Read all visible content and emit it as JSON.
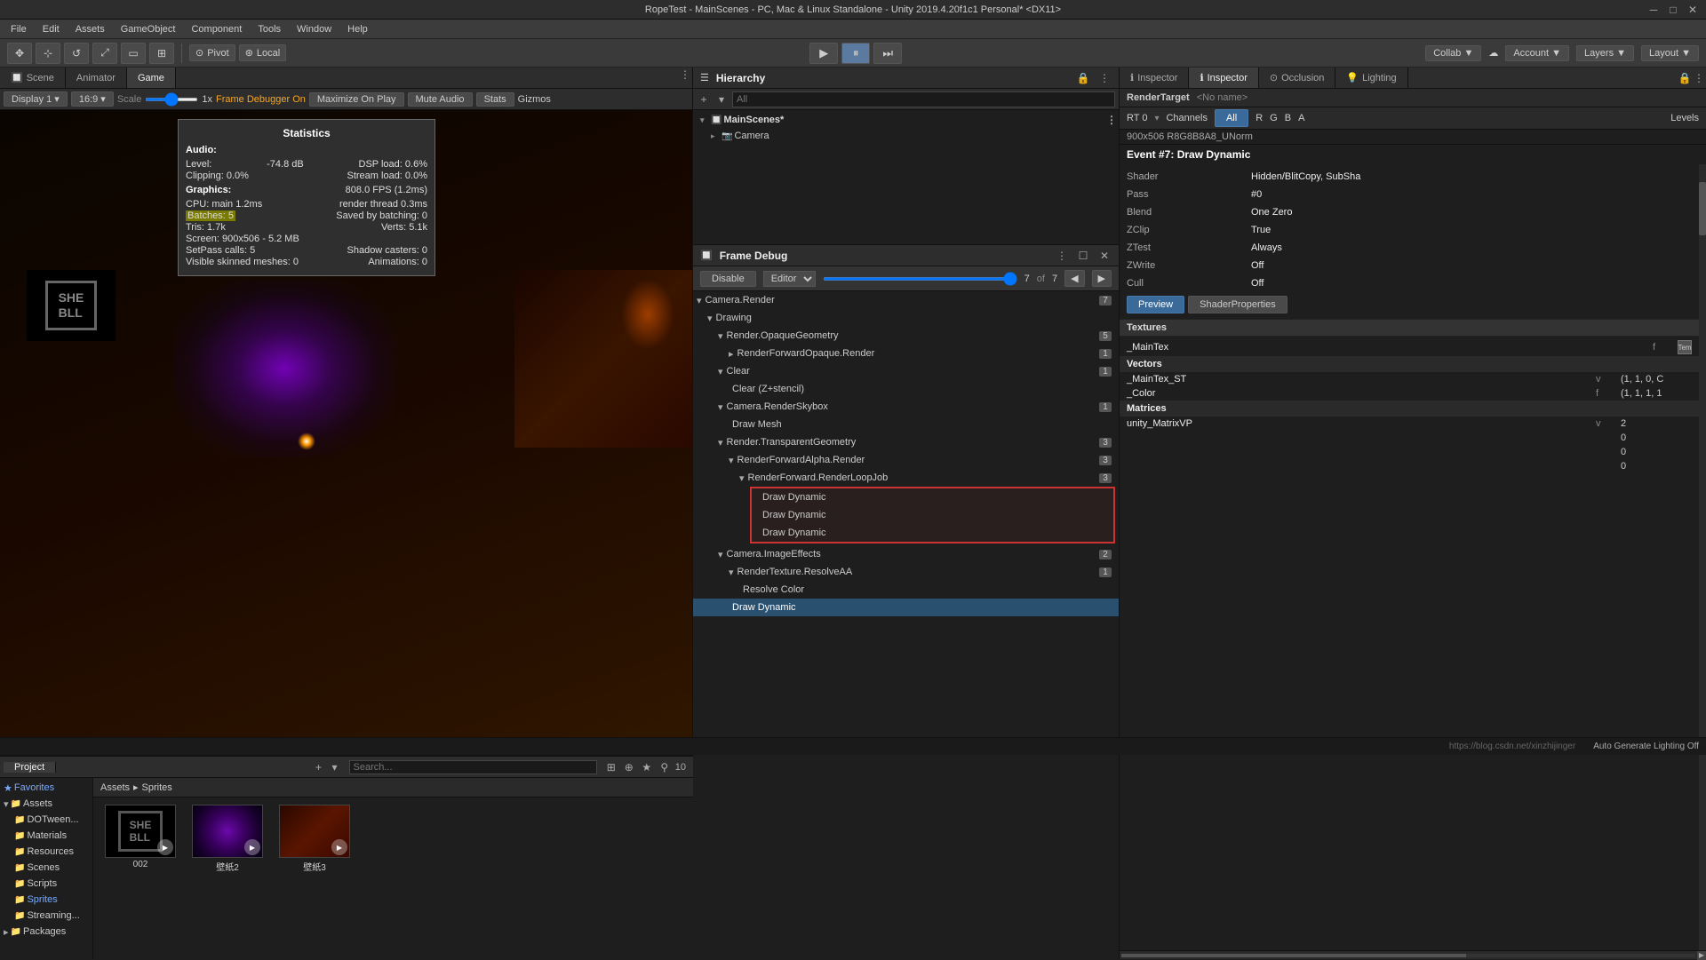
{
  "window": {
    "title": "RopeTest - MainScenes - PC, Mac & Linux Standalone - Unity 2019.4.20f1c1 Personal* <DX11>"
  },
  "menu": {
    "items": [
      "File",
      "Edit",
      "Assets",
      "GameObject",
      "Component",
      "Tools",
      "Window",
      "Help"
    ]
  },
  "toolbar": {
    "pivot_label": "Pivot",
    "local_label": "Local",
    "play_icon": "▶",
    "pause_icon": "⏸",
    "step_icon": "⏭",
    "collab_label": "Collab ▼",
    "account_label": "Account ▼",
    "layers_label": "Layers ▼",
    "layout_label": "Layout ▼"
  },
  "scene_tab": {
    "label": "Scene",
    "animator_label": "Animator",
    "game_label": "Game",
    "display_label": "Display 1",
    "aspect_label": "16:9",
    "scale_label": "Scale",
    "scale_value": "1x",
    "frame_debugger_label": "Frame Debugger On",
    "maximize_on_play": "Maximize On Play",
    "mute_audio": "Mute Audio",
    "stats_label": "Stats",
    "gizmos_label": "Gizmos"
  },
  "statistics": {
    "title": "Statistics",
    "audio": {
      "label": "Audio:",
      "level_label": "Level:",
      "level_value": "-74.8 dB",
      "dsp_label": "DSP load: 0.6%",
      "clipping_label": "Clipping: 0.0%",
      "stream_label": "Stream load: 0.0%"
    },
    "graphics": {
      "label": "Graphics:",
      "fps_label": "808.0 FPS (1.2ms)",
      "cpu_label": "CPU: main 1.2ms",
      "cpu_value": "render thread 0.3ms",
      "batches_label": "Batches: 5",
      "saved_label": "Saved by batching: 0",
      "tris_label": "Tris: 1.7k",
      "verts_label": "Verts: 5.1k",
      "screen_label": "Screen: 900x506 - 5.2 MB",
      "setpass_label": "SetPass calls: 5",
      "shadow_label": "Shadow casters: 0",
      "skinned_label": "Visible skinned meshes: 0",
      "animations_label": "Animations: 0"
    }
  },
  "hierarchy": {
    "title": "Hierarchy",
    "search_placeholder": "All",
    "items": [
      {
        "label": "MainScenes*",
        "indent": 0,
        "expanded": true,
        "is_scene": true
      },
      {
        "label": "Camera",
        "indent": 1,
        "expanded": false
      }
    ]
  },
  "frame_debugger": {
    "title": "Frame Debug",
    "disable_label": "Disable",
    "editor_label": "Editor",
    "event_number": "7",
    "event_total": "7",
    "tree": [
      {
        "label": "Camera.Render",
        "indent": 0,
        "badge": "7",
        "expanded": true
      },
      {
        "label": "Drawing",
        "indent": 1,
        "badge": "",
        "expanded": true
      },
      {
        "label": "Render.OpaqueGeometry",
        "indent": 2,
        "badge": "5",
        "expanded": true
      },
      {
        "label": "RenderForwardOpaque.Render",
        "indent": 3,
        "badge": "1",
        "expanded": false
      },
      {
        "label": "Clear",
        "indent": 2,
        "badge": "1",
        "expanded": false
      },
      {
        "label": "Clear (Z+stencil)",
        "indent": 3,
        "badge": "",
        "expanded": false
      },
      {
        "label": "Camera.RenderSkybox",
        "indent": 2,
        "badge": "1",
        "expanded": false
      },
      {
        "label": "Draw Mesh",
        "indent": 3,
        "badge": "",
        "expanded": false
      },
      {
        "label": "Render.TransparentGeometry",
        "indent": 2,
        "badge": "3",
        "expanded": true
      },
      {
        "label": "RenderForwardAlpha.Render",
        "indent": 3,
        "badge": "3",
        "expanded": true
      },
      {
        "label": "RenderForward.RenderLoopJob",
        "indent": 4,
        "badge": "3",
        "expanded": true
      },
      {
        "label": "Draw Dynamic",
        "indent": 5,
        "badge": "",
        "highlight": false
      },
      {
        "label": "Draw Dynamic",
        "indent": 5,
        "badge": "",
        "highlight": false
      },
      {
        "label": "Draw Dynamic",
        "indent": 5,
        "badge": "",
        "highlight": false
      },
      {
        "label": "Camera.ImageEffects",
        "indent": 2,
        "badge": "2",
        "expanded": true
      },
      {
        "label": "RenderTexture.ResolveAA",
        "indent": 3,
        "badge": "1",
        "expanded": true
      },
      {
        "label": "Resolve Color",
        "indent": 4,
        "badge": "",
        "expanded": false
      },
      {
        "label": "Draw Dynamic",
        "indent": 3,
        "badge": "",
        "selected": true
      }
    ]
  },
  "inspector": {
    "title": "Inspector",
    "occlusion_label": "Occlusion",
    "lighting_label": "Lighting",
    "render_target_label": "RenderTarget",
    "no_name": "<No name>",
    "rt0_label": "RT 0",
    "channels_label": "Channels",
    "all_label": "All",
    "r_label": "R",
    "g_label": "G",
    "b_label": "B",
    "a_label": "A",
    "levels_label": "Levels",
    "resolution": "900x506 R8G8B8A8_UNorm",
    "event_label": "Event #7: Draw Dynamic",
    "shader_label": "Shader",
    "shader_value": "Hidden/BlitCopy, SubSha",
    "pass_label": "Pass",
    "pass_value": "#0",
    "blend_label": "Blend",
    "blend_value": "One Zero",
    "zclip_label": "ZClip",
    "zclip_value": "True",
    "ztest_label": "ZTest",
    "ztest_value": "Always",
    "zwrite_label": "ZWrite",
    "zwrite_value": "Off",
    "cull_label": "Cull",
    "cull_value": "Off",
    "preview_label": "Preview",
    "shader_properties_label": "ShaderProperties",
    "textures_section": "Textures",
    "main_tex_label": "_MainTex",
    "main_tex_type": "f",
    "main_tex_swatch": "Tem",
    "vectors_section": "Vectors",
    "main_tex_st_label": "_MainTex_ST",
    "main_tex_st_type": "v",
    "main_tex_st_value": "(1, 1, 0, C",
    "color_label": "_Color",
    "color_type": "f",
    "color_value": "(1, 1, 1, 1",
    "matrices_section": "Matrices",
    "matrix_label": "unity_MatrixVP",
    "matrix_type": "v",
    "matrix_value1": "2",
    "matrix_value2": "0",
    "matrix_value3": "0",
    "matrix_value4": "0"
  },
  "project": {
    "title": "Project",
    "search_placeholder": "",
    "favorites_label": "Favorites",
    "assets_label": "Assets",
    "packages_label": "Packages",
    "folders": [
      "DOTween...",
      "Materials",
      "Resources",
      "Scenes",
      "Scripts",
      "Sprites",
      "Streaming..."
    ],
    "breadcrumb": [
      "Assets",
      "Sprites"
    ],
    "assets": [
      {
        "name": "002",
        "type": "video"
      },
      {
        "name": "壁紙2",
        "type": "video"
      },
      {
        "name": "壁紙3",
        "type": "video"
      }
    ],
    "icon_count": "10"
  },
  "status_bar": {
    "url": "https://blog.csdn.net/xinzhijinger",
    "lighting_label": "Auto Generate Lighting Off"
  }
}
